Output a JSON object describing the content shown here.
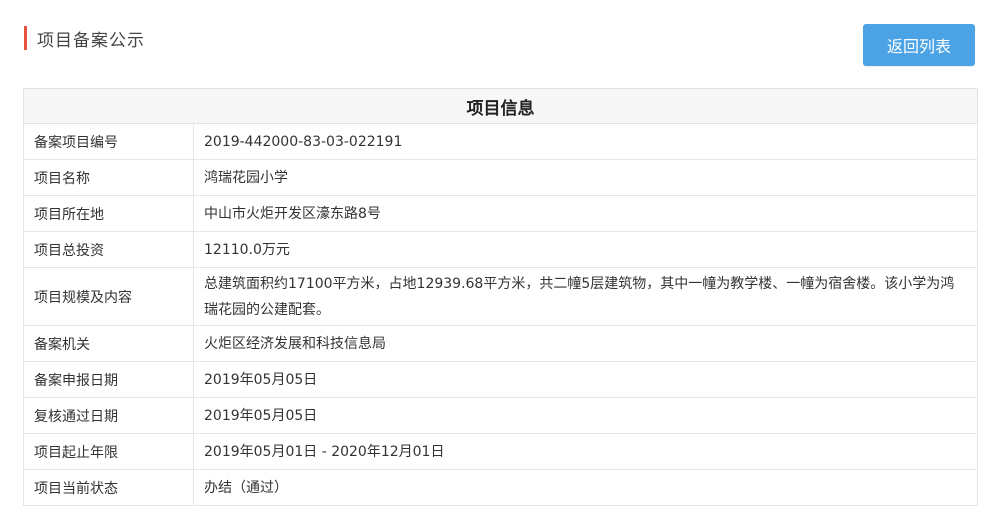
{
  "header": {
    "title": "项目备案公示",
    "accent_color": "#e8533f"
  },
  "actions": {
    "back_label": "返回列表",
    "back_color": "#4ba3e6"
  },
  "table": {
    "caption": "项目信息",
    "rows": [
      {
        "label": "备案项目编号",
        "value": "2019-442000-83-03-022191"
      },
      {
        "label": "项目名称",
        "value": "鸿瑞花园小学"
      },
      {
        "label": "项目所在地",
        "value": "中山市火炬开发区濠东路8号"
      },
      {
        "label": "项目总投资",
        "value": "12110.0万元"
      },
      {
        "label": "项目规模及内容",
        "value": "总建筑面积约17100平方米，占地12939.68平方米，共二幢5层建筑物，其中一幢为教学楼、一幢为宿舍楼。该小学为鸿瑞花园的公建配套。"
      },
      {
        "label": "备案机关",
        "value": "火炬区经济发展和科技信息局"
      },
      {
        "label": "备案申报日期",
        "value": "2019年05月05日"
      },
      {
        "label": "复核通过日期",
        "value": "2019年05月05日"
      },
      {
        "label": "项目起止年限",
        "value": "2019年05月01日 - 2020年12月01日"
      },
      {
        "label": "项目当前状态",
        "value": "办结（通过）"
      }
    ]
  }
}
